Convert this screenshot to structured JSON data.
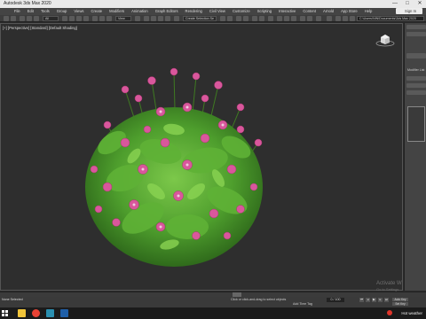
{
  "window": {
    "title": "Autodesk 3ds Max 2020",
    "minimize": "—",
    "maximize": "□",
    "close": "✕"
  },
  "menu": {
    "items": [
      "File",
      "Edit",
      "Tools",
      "Group",
      "Views",
      "Create",
      "Modifiers",
      "Animation",
      "Graph Editors",
      "Rendering",
      "Civil View",
      "Customize",
      "Scripting",
      "Interactive",
      "Content",
      "Arnold",
      "App Store",
      "Help"
    ],
    "signin": "Sign In"
  },
  "toolbar": {
    "selection_filter": "All",
    "view_dropdown": "View",
    "selection_set": "Create Selection Se",
    "project_path": "C:\\Users\\NIN\\Documents\\3ds Max 2020"
  },
  "viewport": {
    "label": "[+] [Perspective] [Standard] [Default Shading]"
  },
  "command_panel": {
    "modifier_list": "Modifier List"
  },
  "status": {
    "object_count": "None Selected",
    "prompt": "Click or click-and-drag to select objects",
    "add_time_tag": "Add Time Tag",
    "frame": "0 / 100",
    "auto_key": "Auto Key",
    "set_key": "Set Key",
    "selected": "Selected"
  },
  "watermark": {
    "line1": "Activate W",
    "line2": "Go to Settings"
  },
  "taskbar": {
    "weather": "Hot weather",
    "apps": [
      "file-explorer-icon",
      "chrome-icon",
      "3dsmax-icon",
      "photoshop-icon"
    ]
  }
}
